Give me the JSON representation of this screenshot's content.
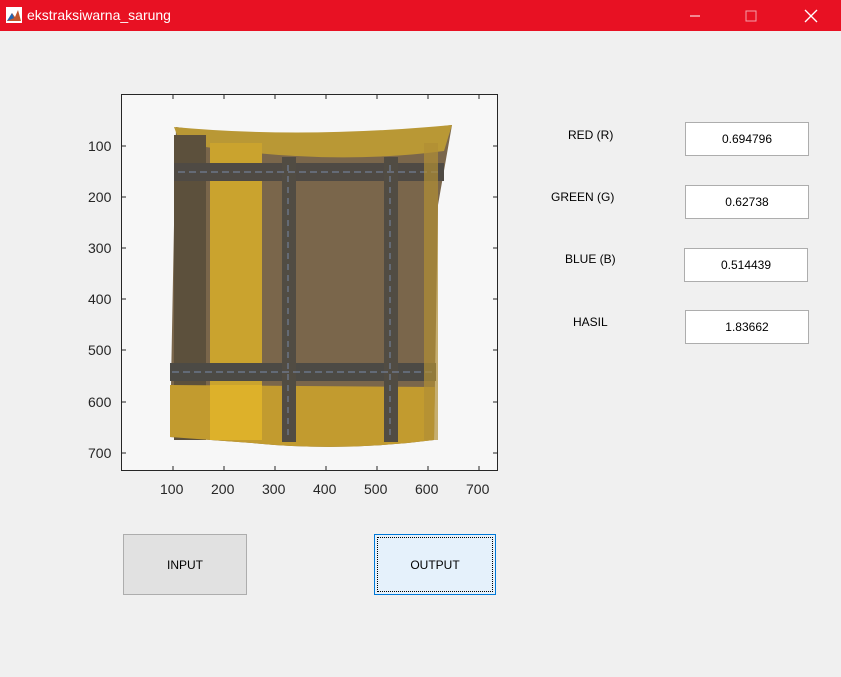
{
  "window": {
    "title": "ekstraksiwarna_sarung",
    "titlebar_color": "#e81123",
    "controls": [
      "minimize-icon",
      "maximize-icon",
      "close-icon"
    ]
  },
  "axes": {
    "content": "image of a brown and yellow plaid sarong hanging against a white background",
    "x_ticks": [
      "100",
      "200",
      "300",
      "400",
      "500",
      "600",
      "700"
    ],
    "y_ticks": [
      "100",
      "200",
      "300",
      "400",
      "500",
      "600",
      "700"
    ]
  },
  "fields": {
    "red": {
      "label": "RED (R)",
      "value": "0.694796"
    },
    "green": {
      "label": "GREEN (G)",
      "value": "0.62738"
    },
    "blue": {
      "label": "BLUE (B)",
      "value": "0.514439"
    },
    "hasil": {
      "label": "HASIL",
      "value": "1.83662"
    }
  },
  "buttons": {
    "input": "INPUT",
    "output": "OUTPUT"
  },
  "colors": {
    "button_focused_bg": "#e5f1fb",
    "button_focused_border": "#0078d7",
    "button_bg": "#e1e1e1"
  }
}
